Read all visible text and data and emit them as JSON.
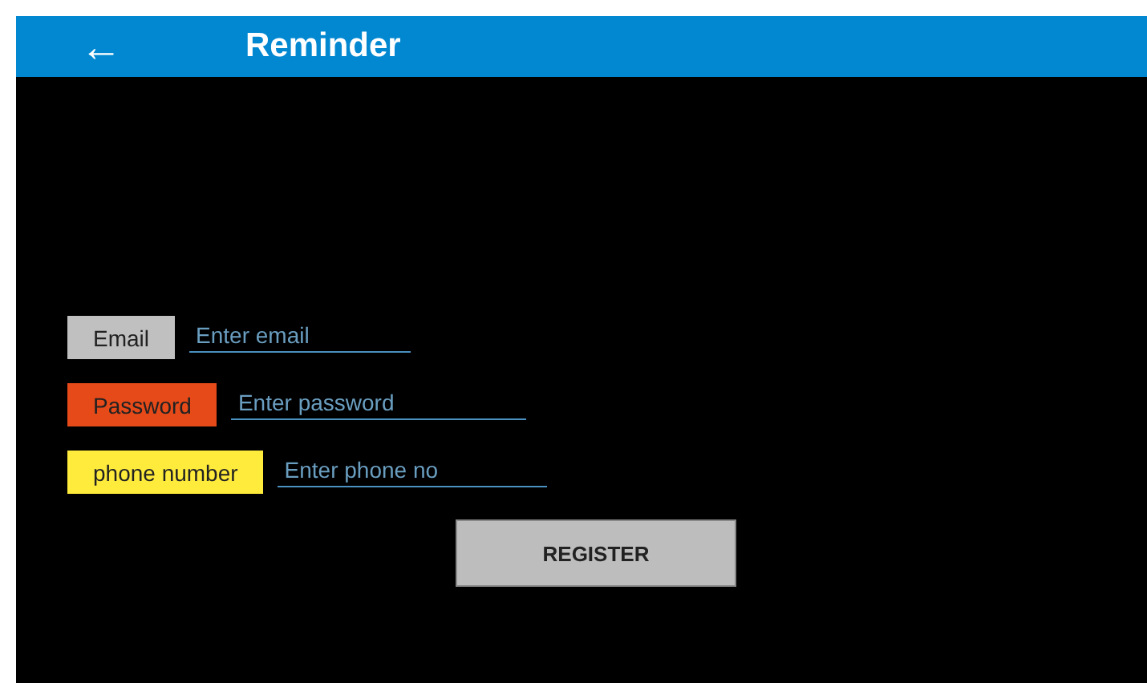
{
  "app_bar": {
    "back": "←",
    "title": "Reminder"
  },
  "fields": [
    {
      "label": "Email",
      "color": "#c0c0c0",
      "placeholder": "Enter email"
    },
    {
      "label": "Password",
      "color": "#e64a19",
      "placeholder": "Enter password"
    },
    {
      "label": "phone number",
      "color": "#ffeb3b",
      "placeholder": "Enter phone no"
    }
  ],
  "button": "REGISTER"
}
